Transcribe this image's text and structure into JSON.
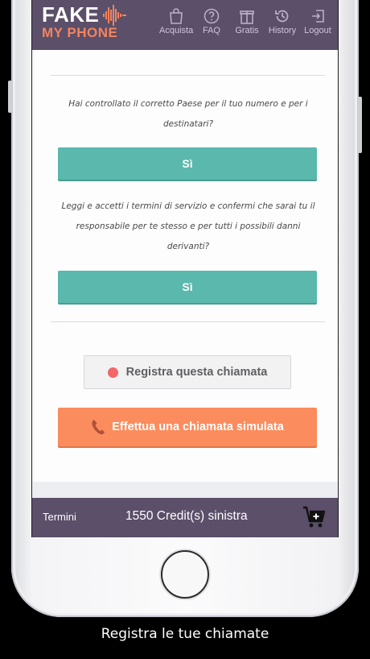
{
  "app": {
    "logo_top": "FAKE",
    "logo_bottom": "MY PHONE"
  },
  "nav": {
    "items": [
      {
        "label": "Acquista",
        "icon": "shopping-bag-icon"
      },
      {
        "label": "FAQ",
        "icon": "question-icon"
      },
      {
        "label": "Gratis",
        "icon": "gift-icon"
      },
      {
        "label": "History",
        "icon": "history-icon"
      },
      {
        "label": "Logout",
        "icon": "logout-icon"
      }
    ]
  },
  "main": {
    "question_country": "Hai controllato il corretto Paese per il tuo numero e per i destinatari?",
    "yes_label_1": "Sì",
    "question_terms": "Leggi e accetti i termini di servizio e confermi che sarai tu il responsabile per te stesso e per tutti i possibili danni derivanti?",
    "yes_label_2": "Sì",
    "record_label": "Registra questa chiamata",
    "call_label": "Effettua una chiamata simulata"
  },
  "footer": {
    "terms": "Termini",
    "credits": "1550 Credit(s) sinistra"
  },
  "caption": "Registra le tue chiamate",
  "colors": {
    "header": "#5b4f69",
    "accent_orange": "#fb8c5d",
    "teal": "#5bb8ad",
    "record_red": "#f26768"
  }
}
